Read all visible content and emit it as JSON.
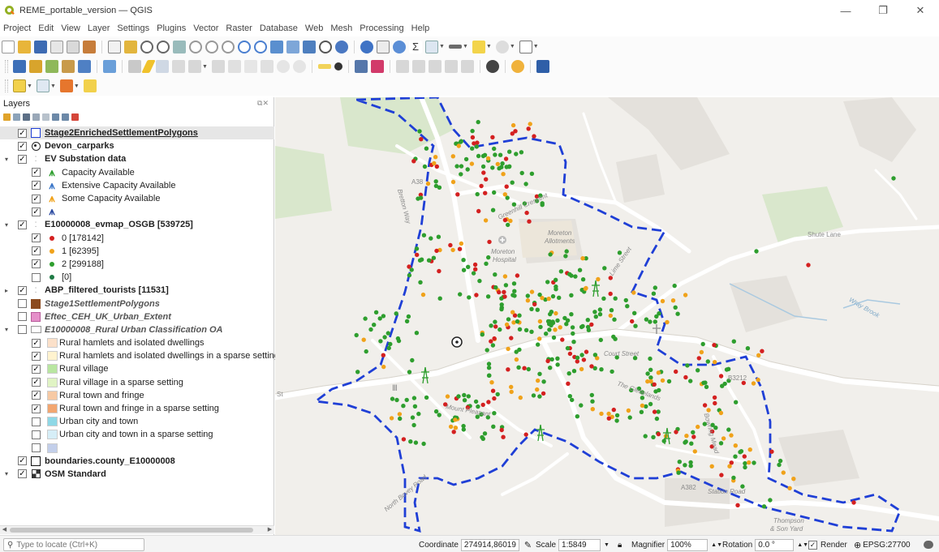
{
  "window": {
    "title": "REME_portable_version — QGIS",
    "min_glyph": "—",
    "max_glyph": "❐",
    "close_glyph": "✕"
  },
  "menu": [
    "Project",
    "Edit",
    "View",
    "Layer",
    "Settings",
    "Plugins",
    "Vector",
    "Raster",
    "Database",
    "Web",
    "Mesh",
    "Processing",
    "Help"
  ],
  "layers_panel": {
    "title": "Layers",
    "items": [
      {
        "label": "Stage2EnrichedSettlementPolygons",
        "indent": 0,
        "checked": true,
        "style": "bold ul",
        "symbol": "poly-outline-blue",
        "expander": "",
        "selected": true
      },
      {
        "label": "Devon_carparks",
        "indent": 0,
        "checked": true,
        "style": "bold",
        "symbol": "point-target",
        "expander": ""
      },
      {
        "label": "EV Substation data",
        "indent": 0,
        "checked": true,
        "style": "bold",
        "symbol": "rule-points",
        "expander": "▾"
      },
      {
        "label": "Capacity Available",
        "indent": 1,
        "checked": true,
        "style": "",
        "symbol": "pylon-green",
        "expander": ""
      },
      {
        "label": "Extensive Capacity Available",
        "indent": 1,
        "checked": true,
        "style": "",
        "symbol": "pylon-blue",
        "expander": ""
      },
      {
        "label": "Some Capacity Available",
        "indent": 1,
        "checked": true,
        "style": "",
        "symbol": "pylon-orange",
        "expander": ""
      },
      {
        "label": "",
        "indent": 1,
        "checked": true,
        "style": "",
        "symbol": "pylon-darkblue",
        "expander": ""
      },
      {
        "label": "E10000008_evmap_OSGB [539725]",
        "indent": 0,
        "checked": true,
        "style": "bold",
        "symbol": "rule-points",
        "expander": "▾"
      },
      {
        "label": "0 [178142]",
        "indent": 1,
        "checked": true,
        "style": "",
        "symbol": "dot-red",
        "expander": ""
      },
      {
        "label": "1 [62395]",
        "indent": 1,
        "checked": true,
        "style": "",
        "symbol": "dot-orange",
        "expander": ""
      },
      {
        "label": "2 [299188]",
        "indent": 1,
        "checked": true,
        "style": "",
        "symbol": "dot-green",
        "expander": ""
      },
      {
        "label": "[0]",
        "indent": 1,
        "checked": false,
        "style": "",
        "symbol": "dot-darkgreen",
        "expander": ""
      },
      {
        "label": "ABP_filtered_tourists [11531]",
        "indent": 0,
        "checked": true,
        "style": "bold",
        "symbol": "rule-points",
        "expander": "▸"
      },
      {
        "label": "Stage1SettlementPolygons",
        "indent": 0,
        "checked": false,
        "style": "bold ital",
        "symbol": "poly-brown",
        "expander": ""
      },
      {
        "label": "Eftec_CEH_UK_Urban_Extent",
        "indent": 0,
        "checked": false,
        "style": "bold ital",
        "symbol": "poly-pink",
        "expander": ""
      },
      {
        "label": "E10000008_Rural Urban Classification OA",
        "indent": 0,
        "checked": false,
        "style": "bold ital",
        "symbol": "poly-cat",
        "expander": "▾"
      },
      {
        "label": "Rural hamlets and isolated dwellings",
        "indent": 1,
        "checked": true,
        "style": "",
        "symbol": "sw-peach",
        "expander": ""
      },
      {
        "label": "Rural hamlets and isolated dwellings in a sparse setting",
        "indent": 1,
        "checked": true,
        "style": "",
        "symbol": "sw-cream",
        "expander": ""
      },
      {
        "label": "Rural village",
        "indent": 1,
        "checked": true,
        "style": "",
        "symbol": "sw-lightgreen",
        "expander": ""
      },
      {
        "label": "Rural village in a sparse setting",
        "indent": 1,
        "checked": true,
        "style": "",
        "symbol": "sw-palegreen",
        "expander": ""
      },
      {
        "label": "Rural town and fringe",
        "indent": 1,
        "checked": true,
        "style": "",
        "symbol": "sw-tan",
        "expander": ""
      },
      {
        "label": "Rural town and fringe in a sparse setting",
        "indent": 1,
        "checked": true,
        "style": "",
        "symbol": "sw-orange",
        "expander": ""
      },
      {
        "label": "Urban city and town",
        "indent": 1,
        "checked": false,
        "style": "",
        "symbol": "sw-cyan",
        "expander": ""
      },
      {
        "label": "Urban city and town in a sparse setting",
        "indent": 1,
        "checked": false,
        "style": "",
        "symbol": "sw-paleblue",
        "expander": ""
      },
      {
        "label": "",
        "indent": 1,
        "checked": false,
        "style": "",
        "symbol": "sw-lavender",
        "expander": ""
      },
      {
        "label": "boundaries.county_E10000008",
        "indent": 0,
        "checked": true,
        "style": "bold",
        "symbol": "poly-outline-black",
        "expander": ""
      },
      {
        "label": "OSM Standard",
        "indent": 0,
        "checked": true,
        "style": "bold",
        "symbol": "raster",
        "expander": "▾"
      }
    ]
  },
  "map_labels": {
    "a38": "A38",
    "bretton_way": "Bretton Way",
    "moreton_allotments_1": "Moreton",
    "moreton_allotments_2": "Allotments",
    "moreton_hospital_1": "Moreton",
    "moreton_hospital_2": "Hospital",
    "shute_lane": "Shute Lane",
    "wray_brook": "Wray Brook",
    "greenhill_crescent": "Greenhill Crescent",
    "lime_street": "Lime Street",
    "court_street": "Court Street",
    "mount_pleasant": "Mount Pleasant",
    "the_glebelands": "The Glebelands",
    "b3212": "B3212",
    "a382": "A382",
    "station_road": "Station Road",
    "bowring_mead": "Bowring Mead",
    "north_bovey_road": "North Bovey Road",
    "thompson_1": "Thompson",
    "thompson_2": "& Son Yard",
    "st": "St"
  },
  "statusbar": {
    "locator_placeholder": "Type to locate (Ctrl+K)",
    "coordinate_label": "Coordinate",
    "coordinate_value": "274914,86019",
    "scale_label": "Scale",
    "scale_value": "1:5849",
    "magnifier_label": "Magnifier",
    "magnifier_value": "100%",
    "rotation_label": "Rotation",
    "rotation_value": "0.0 °",
    "render_label": "Render",
    "crs_label": "EPSG:27700"
  },
  "colors": {
    "boundary": "#1f3fd6",
    "point_red": "#d42020",
    "point_orange": "#f0a21a",
    "point_green": "#2e9e2e",
    "road": "#ffffff",
    "map_bg": "#f1efeb"
  }
}
